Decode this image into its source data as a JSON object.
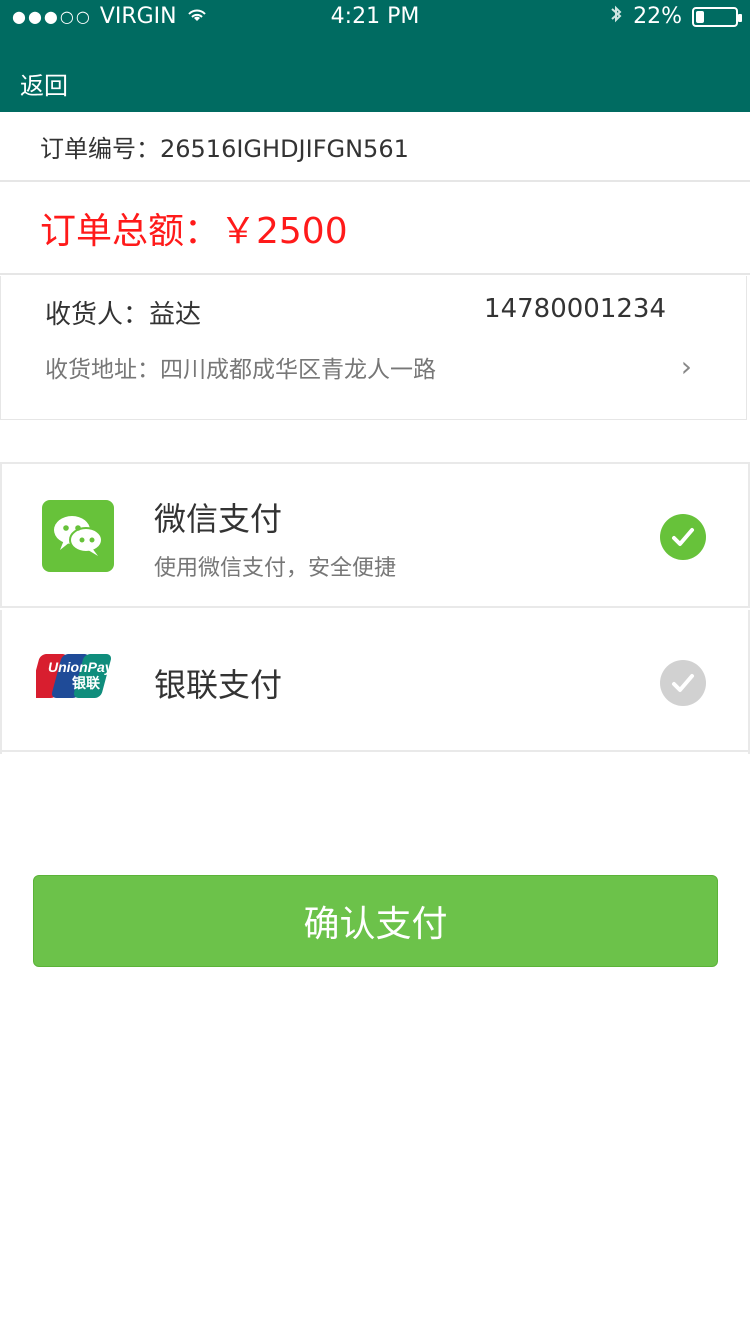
{
  "status": {
    "carrier": "VIRGIN",
    "time": "4:21 PM",
    "battery_percent": "22%",
    "battery_level": 0.22
  },
  "nav": {
    "back_label": "返回"
  },
  "order": {
    "number_text": "订单编号：26516IGHDJIFGN561",
    "total_text": "订单总额：￥2500"
  },
  "address": {
    "receiver_text": "收货人：益达",
    "phone": "14780001234",
    "address_text": "收货地址：四川成都成华区青龙人一路",
    "chevron": "›"
  },
  "payments": {
    "wechat": {
      "title": "微信支付",
      "subtitle": "使用微信支付，安全便捷",
      "selected": true
    },
    "unionpay": {
      "title": "银联支付",
      "selected": false,
      "logo_text_en": "UnionPay",
      "logo_text_cn": "银联"
    }
  },
  "confirm": {
    "label": "确认支付"
  },
  "colors": {
    "header": "#006B61",
    "accent_green": "#67C23A",
    "total_red": "#FF1A1A"
  },
  "icons": {
    "wifi": "wifi-icon",
    "bluetooth": "bluetooth-icon",
    "battery": "battery-icon",
    "wechat": "wechat-icon",
    "unionpay": "unionpay-logo",
    "checkmark": "check-icon",
    "chevron": "chevron-right-icon"
  }
}
